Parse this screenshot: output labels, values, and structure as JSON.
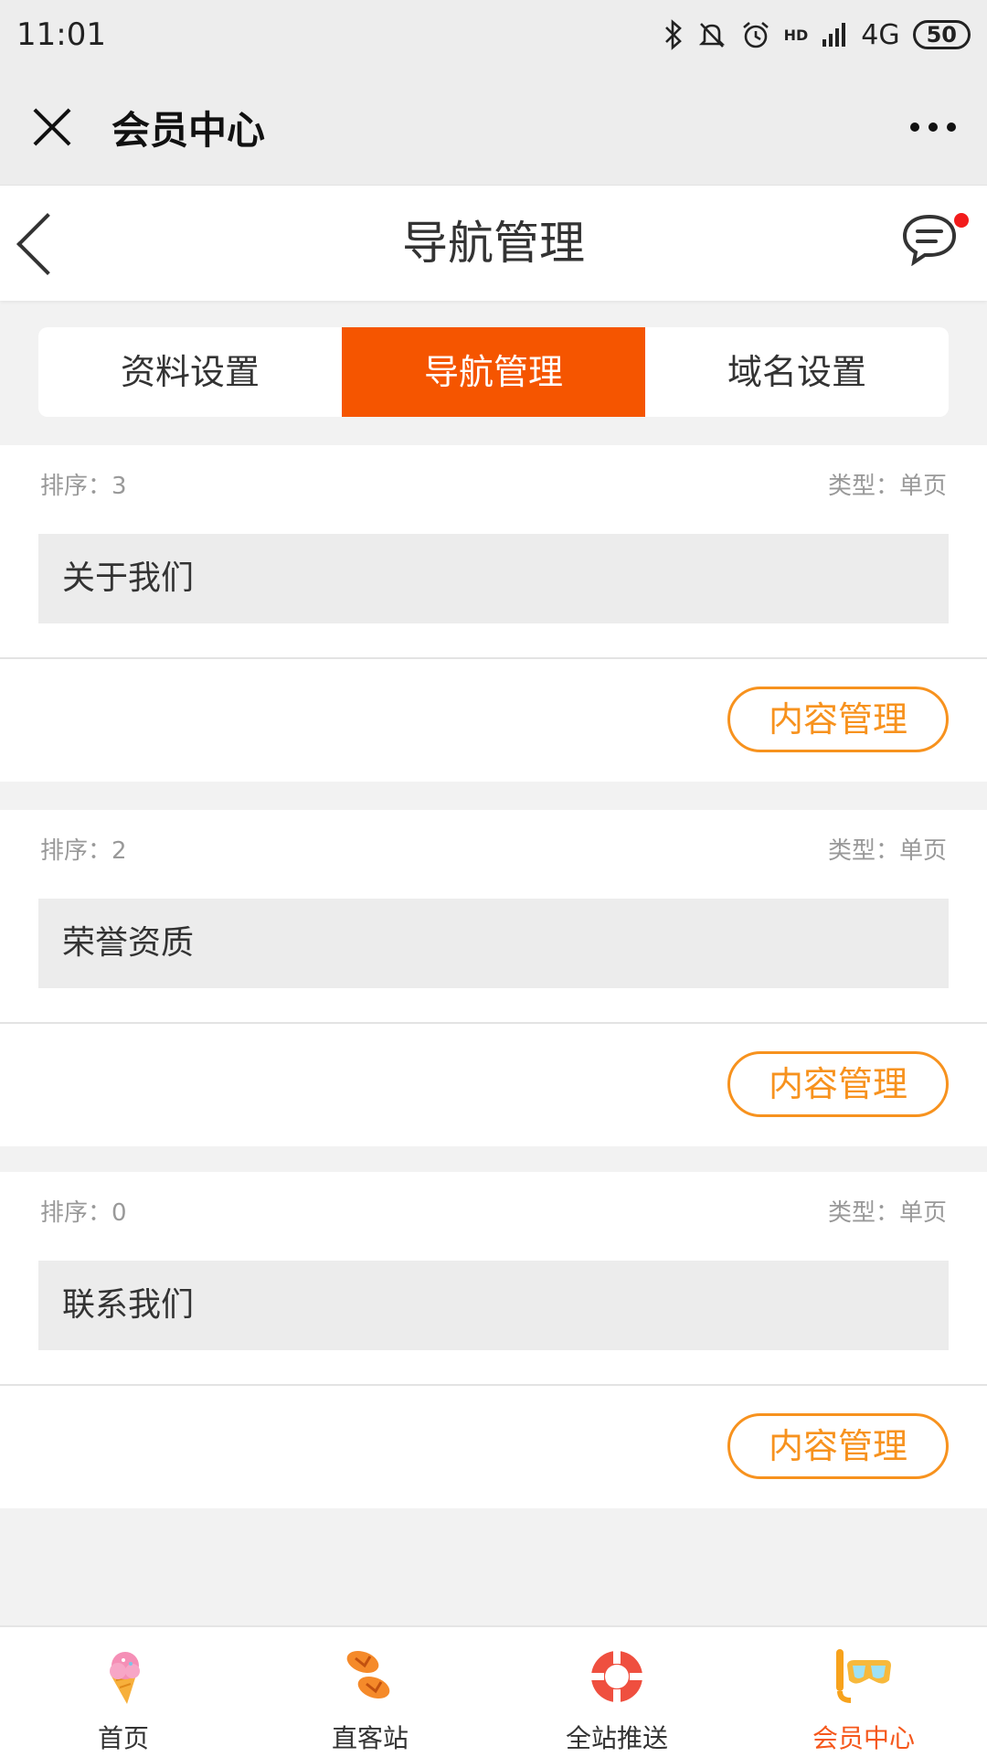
{
  "status": {
    "time": "11:01",
    "network": "4G",
    "hd": "HD",
    "battery": "50"
  },
  "wechat": {
    "title": "会员中心"
  },
  "header": {
    "title": "导航管理"
  },
  "tabs": [
    {
      "label": "资料设置"
    },
    {
      "label": "导航管理"
    },
    {
      "label": "域名设置"
    }
  ],
  "colors": {
    "accent": "#f55500",
    "button_border": "#f7921e",
    "active_tab_text": "#f5571b",
    "badge": "#f21c1c"
  },
  "items": [
    {
      "sort_label": "排序：3",
      "type_label": "类型：单页",
      "name": "关于我们",
      "button": "内容管理"
    },
    {
      "sort_label": "排序：2",
      "type_label": "类型：单页",
      "name": "荣誉资质",
      "button": "内容管理"
    },
    {
      "sort_label": "排序：0",
      "type_label": "类型：单页",
      "name": "联系我们",
      "button": "内容管理"
    }
  ],
  "tabbar": [
    {
      "label": "首页",
      "icon": "ice-cream-icon"
    },
    {
      "label": "直客站",
      "icon": "flip-flops-icon"
    },
    {
      "label": "全站推送",
      "icon": "lifebuoy-icon"
    },
    {
      "label": "会员中心",
      "icon": "snorkel-mask-icon"
    }
  ]
}
